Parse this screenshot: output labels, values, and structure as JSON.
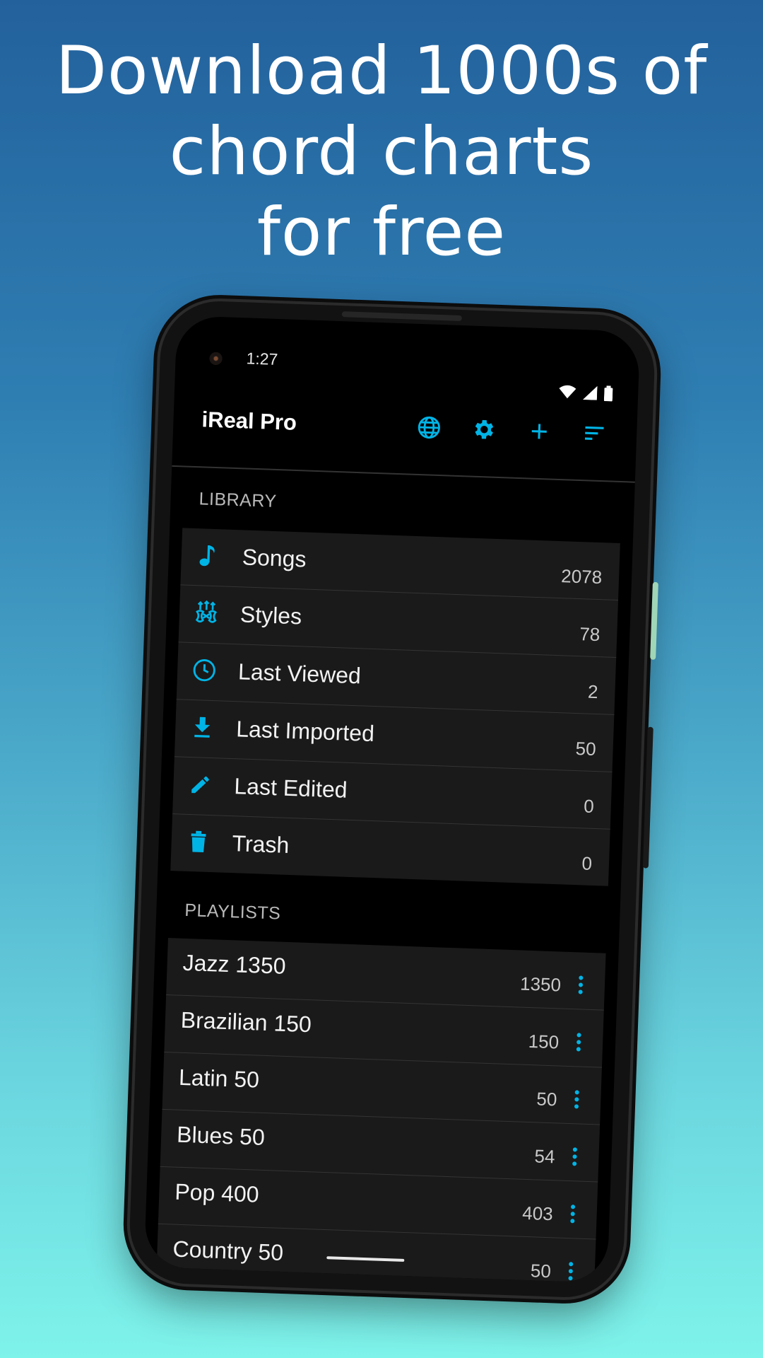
{
  "headline": {
    "line1": "Download 1000s of",
    "line2": "chord charts",
    "line3": "for free"
  },
  "status_bar": {
    "time": "1:27",
    "icons": [
      "wifi-icon",
      "cell-signal-icon",
      "battery-icon"
    ]
  },
  "app_bar": {
    "title": "iReal Pro",
    "actions": [
      "globe-icon",
      "gear-icon",
      "plus-icon",
      "sort-icon"
    ]
  },
  "library": {
    "label": "LIBRARY",
    "items": [
      {
        "label": "Songs",
        "count": "2078",
        "icon": "music-note-icon"
      },
      {
        "label": "Styles",
        "count": "78",
        "icon": "styles-icon"
      },
      {
        "label": "Last Viewed",
        "count": "2",
        "icon": "clock-icon"
      },
      {
        "label": "Last Imported",
        "count": "50",
        "icon": "download-icon"
      },
      {
        "label": "Last Edited",
        "count": "0",
        "icon": "pencil-icon"
      },
      {
        "label": "Trash",
        "count": "0",
        "icon": "trash-icon"
      }
    ]
  },
  "playlists": {
    "label": "PLAYLISTS",
    "items": [
      {
        "label": "Jazz 1350",
        "count": "1350"
      },
      {
        "label": "Brazilian 150",
        "count": "150"
      },
      {
        "label": "Latin 50",
        "count": "50"
      },
      {
        "label": "Blues 50",
        "count": "54"
      },
      {
        "label": "Pop 400",
        "count": "403"
      },
      {
        "label": "Country 50",
        "count": "50"
      }
    ]
  },
  "colors": {
    "accent": "#00b4e6",
    "screen_bg": "#000000",
    "row_bg": "#1a1a1a"
  }
}
